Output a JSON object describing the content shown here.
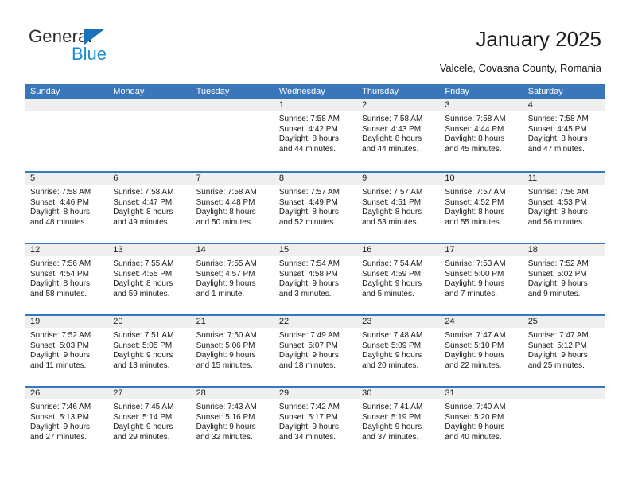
{
  "brand": {
    "name_part1": "General",
    "name_part2": "Blue",
    "accent_color": "#1a8cd8",
    "triangle_color": "#1a72ba"
  },
  "header": {
    "title": "January 2025",
    "subtitle": "Valcele, Covasna County, Romania"
  },
  "calendar": {
    "header_color": "#3a76ba",
    "daynum_band_color": "#efefef",
    "weekdays": [
      "Sunday",
      "Monday",
      "Tuesday",
      "Wednesday",
      "Thursday",
      "Friday",
      "Saturday"
    ],
    "weeks": [
      [
        {
          "day": "",
          "empty": true
        },
        {
          "day": "",
          "empty": true
        },
        {
          "day": "",
          "empty": true
        },
        {
          "day": "1",
          "sunrise": "Sunrise: 7:58 AM",
          "sunset": "Sunset: 4:42 PM",
          "daylight1": "Daylight: 8 hours",
          "daylight2": "and 44 minutes."
        },
        {
          "day": "2",
          "sunrise": "Sunrise: 7:58 AM",
          "sunset": "Sunset: 4:43 PM",
          "daylight1": "Daylight: 8 hours",
          "daylight2": "and 44 minutes."
        },
        {
          "day": "3",
          "sunrise": "Sunrise: 7:58 AM",
          "sunset": "Sunset: 4:44 PM",
          "daylight1": "Daylight: 8 hours",
          "daylight2": "and 45 minutes."
        },
        {
          "day": "4",
          "sunrise": "Sunrise: 7:58 AM",
          "sunset": "Sunset: 4:45 PM",
          "daylight1": "Daylight: 8 hours",
          "daylight2": "and 47 minutes."
        }
      ],
      [
        {
          "day": "5",
          "sunrise": "Sunrise: 7:58 AM",
          "sunset": "Sunset: 4:46 PM",
          "daylight1": "Daylight: 8 hours",
          "daylight2": "and 48 minutes."
        },
        {
          "day": "6",
          "sunrise": "Sunrise: 7:58 AM",
          "sunset": "Sunset: 4:47 PM",
          "daylight1": "Daylight: 8 hours",
          "daylight2": "and 49 minutes."
        },
        {
          "day": "7",
          "sunrise": "Sunrise: 7:58 AM",
          "sunset": "Sunset: 4:48 PM",
          "daylight1": "Daylight: 8 hours",
          "daylight2": "and 50 minutes."
        },
        {
          "day": "8",
          "sunrise": "Sunrise: 7:57 AM",
          "sunset": "Sunset: 4:49 PM",
          "daylight1": "Daylight: 8 hours",
          "daylight2": "and 52 minutes."
        },
        {
          "day": "9",
          "sunrise": "Sunrise: 7:57 AM",
          "sunset": "Sunset: 4:51 PM",
          "daylight1": "Daylight: 8 hours",
          "daylight2": "and 53 minutes."
        },
        {
          "day": "10",
          "sunrise": "Sunrise: 7:57 AM",
          "sunset": "Sunset: 4:52 PM",
          "daylight1": "Daylight: 8 hours",
          "daylight2": "and 55 minutes."
        },
        {
          "day": "11",
          "sunrise": "Sunrise: 7:56 AM",
          "sunset": "Sunset: 4:53 PM",
          "daylight1": "Daylight: 8 hours",
          "daylight2": "and 56 minutes."
        }
      ],
      [
        {
          "day": "12",
          "sunrise": "Sunrise: 7:56 AM",
          "sunset": "Sunset: 4:54 PM",
          "daylight1": "Daylight: 8 hours",
          "daylight2": "and 58 minutes."
        },
        {
          "day": "13",
          "sunrise": "Sunrise: 7:55 AM",
          "sunset": "Sunset: 4:55 PM",
          "daylight1": "Daylight: 8 hours",
          "daylight2": "and 59 minutes."
        },
        {
          "day": "14",
          "sunrise": "Sunrise: 7:55 AM",
          "sunset": "Sunset: 4:57 PM",
          "daylight1": "Daylight: 9 hours",
          "daylight2": "and 1 minute."
        },
        {
          "day": "15",
          "sunrise": "Sunrise: 7:54 AM",
          "sunset": "Sunset: 4:58 PM",
          "daylight1": "Daylight: 9 hours",
          "daylight2": "and 3 minutes."
        },
        {
          "day": "16",
          "sunrise": "Sunrise: 7:54 AM",
          "sunset": "Sunset: 4:59 PM",
          "daylight1": "Daylight: 9 hours",
          "daylight2": "and 5 minutes."
        },
        {
          "day": "17",
          "sunrise": "Sunrise: 7:53 AM",
          "sunset": "Sunset: 5:00 PM",
          "daylight1": "Daylight: 9 hours",
          "daylight2": "and 7 minutes."
        },
        {
          "day": "18",
          "sunrise": "Sunrise: 7:52 AM",
          "sunset": "Sunset: 5:02 PM",
          "daylight1": "Daylight: 9 hours",
          "daylight2": "and 9 minutes."
        }
      ],
      [
        {
          "day": "19",
          "sunrise": "Sunrise: 7:52 AM",
          "sunset": "Sunset: 5:03 PM",
          "daylight1": "Daylight: 9 hours",
          "daylight2": "and 11 minutes."
        },
        {
          "day": "20",
          "sunrise": "Sunrise: 7:51 AM",
          "sunset": "Sunset: 5:05 PM",
          "daylight1": "Daylight: 9 hours",
          "daylight2": "and 13 minutes."
        },
        {
          "day": "21",
          "sunrise": "Sunrise: 7:50 AM",
          "sunset": "Sunset: 5:06 PM",
          "daylight1": "Daylight: 9 hours",
          "daylight2": "and 15 minutes."
        },
        {
          "day": "22",
          "sunrise": "Sunrise: 7:49 AM",
          "sunset": "Sunset: 5:07 PM",
          "daylight1": "Daylight: 9 hours",
          "daylight2": "and 18 minutes."
        },
        {
          "day": "23",
          "sunrise": "Sunrise: 7:48 AM",
          "sunset": "Sunset: 5:09 PM",
          "daylight1": "Daylight: 9 hours",
          "daylight2": "and 20 minutes."
        },
        {
          "day": "24",
          "sunrise": "Sunrise: 7:47 AM",
          "sunset": "Sunset: 5:10 PM",
          "daylight1": "Daylight: 9 hours",
          "daylight2": "and 22 minutes."
        },
        {
          "day": "25",
          "sunrise": "Sunrise: 7:47 AM",
          "sunset": "Sunset: 5:12 PM",
          "daylight1": "Daylight: 9 hours",
          "daylight2": "and 25 minutes."
        }
      ],
      [
        {
          "day": "26",
          "sunrise": "Sunrise: 7:46 AM",
          "sunset": "Sunset: 5:13 PM",
          "daylight1": "Daylight: 9 hours",
          "daylight2": "and 27 minutes."
        },
        {
          "day": "27",
          "sunrise": "Sunrise: 7:45 AM",
          "sunset": "Sunset: 5:14 PM",
          "daylight1": "Daylight: 9 hours",
          "daylight2": "and 29 minutes."
        },
        {
          "day": "28",
          "sunrise": "Sunrise: 7:43 AM",
          "sunset": "Sunset: 5:16 PM",
          "daylight1": "Daylight: 9 hours",
          "daylight2": "and 32 minutes."
        },
        {
          "day": "29",
          "sunrise": "Sunrise: 7:42 AM",
          "sunset": "Sunset: 5:17 PM",
          "daylight1": "Daylight: 9 hours",
          "daylight2": "and 34 minutes."
        },
        {
          "day": "30",
          "sunrise": "Sunrise: 7:41 AM",
          "sunset": "Sunset: 5:19 PM",
          "daylight1": "Daylight: 9 hours",
          "daylight2": "and 37 minutes."
        },
        {
          "day": "31",
          "sunrise": "Sunrise: 7:40 AM",
          "sunset": "Sunset: 5:20 PM",
          "daylight1": "Daylight: 9 hours",
          "daylight2": "and 40 minutes."
        },
        {
          "day": "",
          "empty": true
        }
      ]
    ]
  }
}
